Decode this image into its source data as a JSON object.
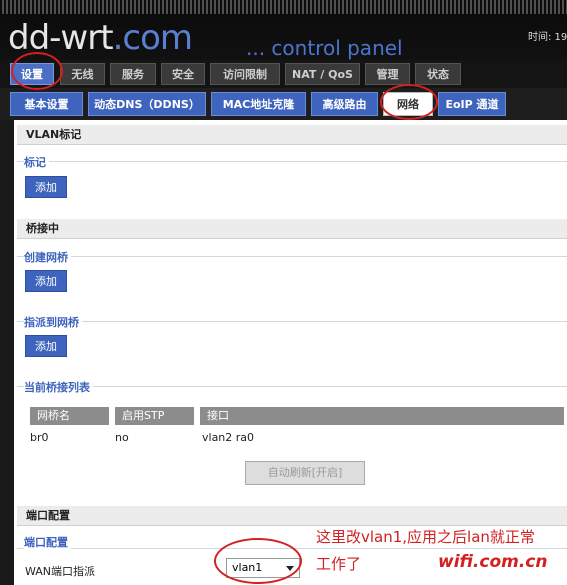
{
  "header": {
    "logo_main": "dd-wrt",
    "logo_suffix": ".com",
    "tagline": "... control panel",
    "time_text": "时间: 19"
  },
  "main_tabs": [
    "设置",
    "无线",
    "服务",
    "安全",
    "访问限制",
    "NAT / QoS",
    "管理",
    "状态"
  ],
  "sub_tabs": [
    "基本设置",
    "动态DNS（DDNS）",
    "MAC地址克隆",
    "高级路由",
    "网络",
    "EoIP 通道"
  ],
  "sections": {
    "vlan": {
      "title": "VLAN标记",
      "tag_legend": "标记",
      "add_label": "添加"
    },
    "bridging": {
      "title": "桥接中",
      "create_legend": "创建网桥",
      "create_add_label": "添加",
      "assign_legend": "指派到网桥",
      "assign_add_label": "添加",
      "list_legend": "当前桥接列表",
      "columns": [
        "网桥名",
        "启用STP",
        "接口"
      ],
      "row": {
        "name": "br0",
        "stp": "no",
        "interfaces": "vlan2 ra0"
      },
      "auto_refresh_label": "自动刷新[开启]"
    },
    "port": {
      "title": "端口配置",
      "legend": "端口配置",
      "wan_label": "WAN端口指派",
      "wan_value": "vlan1"
    }
  },
  "annotations": {
    "note_line1": "这里改vlan1,应用之后lan就正常",
    "note_line2": "工作了",
    "watermark": "wifi.com.cn",
    "highlight_color": "#d32020"
  },
  "colors": {
    "accent_blue": "#3e64be",
    "header_bg": "#0a0a0a"
  }
}
